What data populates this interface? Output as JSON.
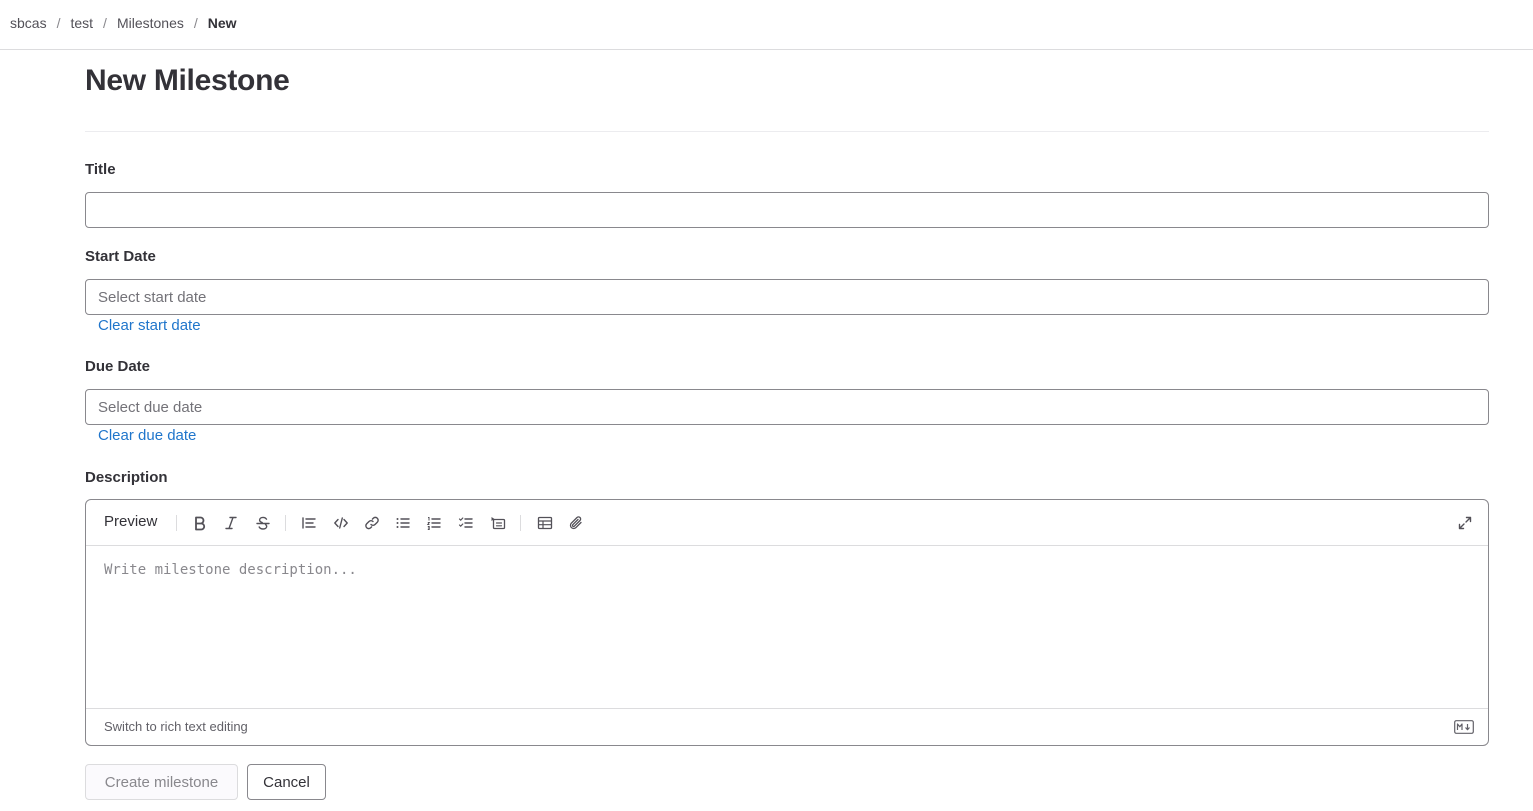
{
  "breadcrumb": {
    "items": [
      "sbcas",
      "test",
      "Milestones",
      "New"
    ],
    "separator": "/"
  },
  "page": {
    "title": "New Milestone"
  },
  "form": {
    "title_label": "Title",
    "title_value": "",
    "start_date_label": "Start Date",
    "start_date_placeholder": "Select start date",
    "clear_start_date": "Clear start date",
    "due_date_label": "Due Date",
    "due_date_placeholder": "Select due date",
    "clear_due_date": "Clear due date",
    "description_label": "Description"
  },
  "editor": {
    "preview_tab": "Preview",
    "toolbar_icons": [
      "bold-icon",
      "italic-icon",
      "strikethrough-icon",
      "quote-icon",
      "code-icon",
      "link-icon",
      "bulleted-list-icon",
      "numbered-list-icon",
      "task-list-icon",
      "collapsible-section-icon",
      "table-icon",
      "attach-file-icon",
      "fullscreen-icon"
    ],
    "placeholder": "Write milestone description...",
    "switch_rich_text": "Switch to rich text editing",
    "markdown_badge": "markdown-icon"
  },
  "actions": {
    "create_label": "Create milestone",
    "cancel_label": "Cancel"
  },
  "colors": {
    "link": "#1f75cb",
    "text": "#333238",
    "border": "#89888d",
    "divider": "#dcdcde"
  }
}
